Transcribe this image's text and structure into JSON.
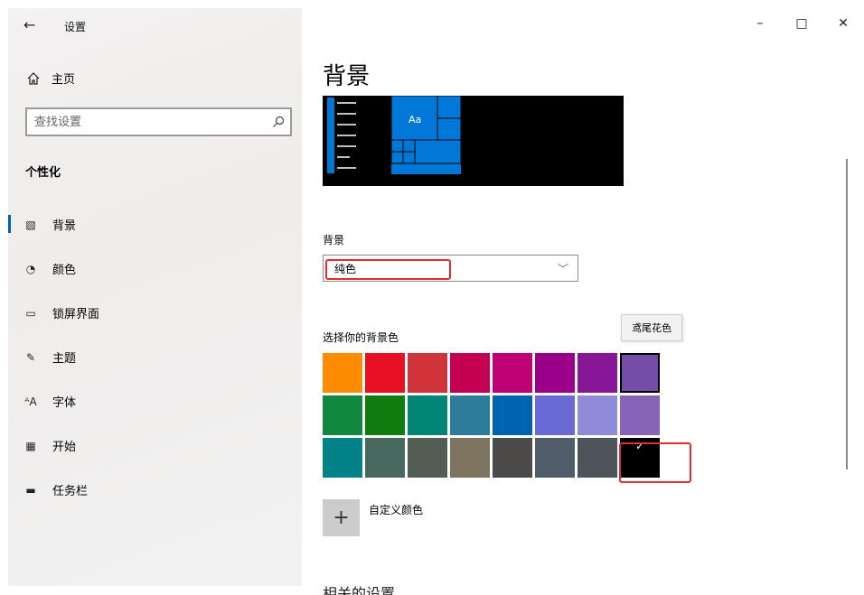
{
  "window": {
    "title": "设置",
    "controls": [
      "–",
      "□",
      "✕"
    ]
  },
  "sidebar": {
    "home_label": "主页",
    "search_placeholder": "查找设置",
    "section_title": "个性化",
    "items": [
      {
        "label": "背景",
        "icon": "picture-icon",
        "glyph": "▧"
      },
      {
        "label": "颜色",
        "icon": "palette-icon",
        "glyph": "◔"
      },
      {
        "label": "锁屏界面",
        "icon": "lock-screen-icon",
        "glyph": "▭"
      },
      {
        "label": "主题",
        "icon": "theme-brush-icon",
        "glyph": "✎"
      },
      {
        "label": "字体",
        "icon": "font-icon",
        "glyph": "ᴬA"
      },
      {
        "label": "开始",
        "icon": "start-grid-icon",
        "glyph": "▦"
      },
      {
        "label": "任务栏",
        "icon": "taskbar-icon",
        "glyph": "▬"
      }
    ]
  },
  "main": {
    "page_title": "背景",
    "background_label": "背景",
    "background_value": "纯色",
    "choose_color_label": "选择你的背景色",
    "tooltip": "鸢尾花色",
    "custom_color_label": "自定义颜色",
    "custom_color_plus": "+",
    "cut_heading": "相关的设置",
    "check_mark": "✓",
    "preview_tile_text": "Aa"
  },
  "colors": {
    "accent": "#0078d7",
    "highlight_red": "#e02d2d",
    "swatches": [
      [
        "#ff8c00",
        "#e81123",
        "#d13438",
        "#c30052",
        "#bf0077",
        "#9a0089",
        "#881798",
        "#744da9"
      ],
      [
        "#10893e",
        "#107c10",
        "#018574",
        "#2d7d9a",
        "#0063b1",
        "#6b69d6",
        "#8e8cd8",
        "#8764b8"
      ],
      [
        "#038387",
        "#486860",
        "#525e54",
        "#7e735f",
        "#4c4a48",
        "#515c6b",
        "#4a5459",
        "#000000"
      ]
    ],
    "selected_swatch": "#000000",
    "hover_swatch": "#744da9"
  }
}
